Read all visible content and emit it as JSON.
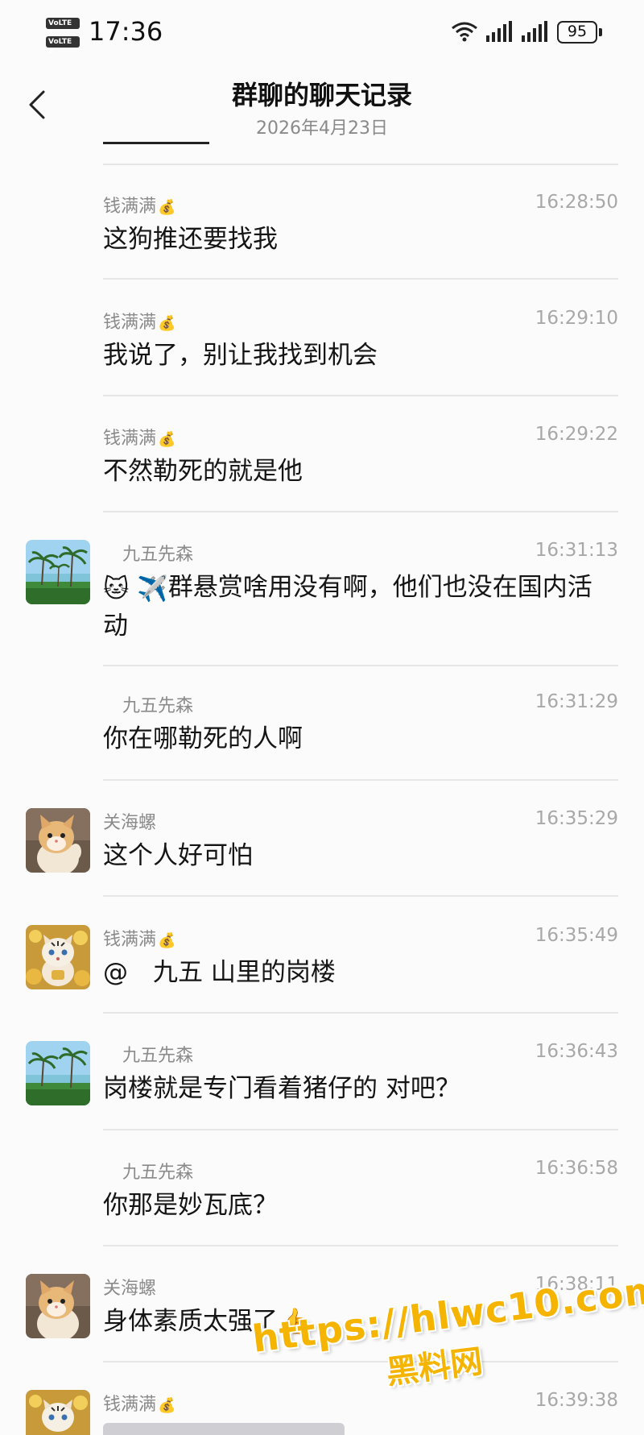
{
  "status_bar": {
    "volte1": "VoLTE 1",
    "volte2": "VoLTE 2",
    "time": "17:36",
    "battery": "95",
    "icons": [
      "wifi-icon",
      "signal-icon",
      "signal-icon",
      "battery-icon"
    ]
  },
  "header": {
    "title": "群聊的聊天记录",
    "date": "2026年4月23日"
  },
  "messages": [
    {
      "sender": "钱满满",
      "badge": "💰",
      "time": "16:28:50",
      "text": "这狗推还要找我",
      "avatar": "none"
    },
    {
      "sender": "钱满满",
      "badge": "💰",
      "time": "16:29:10",
      "text": "我说了，别让我找到机会",
      "avatar": "none"
    },
    {
      "sender": "钱满满",
      "badge": "💰",
      "time": "16:29:22",
      "text": "不然勒死的就是他",
      "avatar": "none"
    },
    {
      "sender": "九五先森",
      "badge": "",
      "time": "16:31:13",
      "text": "群悬赏啥用没有啊，他们也没在国内活动",
      "avatar": "beach-palm-avatar"
    },
    {
      "sender": "九五先森",
      "badge": "",
      "time": "16:31:29",
      "text": "你在哪勒死的人啊",
      "avatar": "none"
    },
    {
      "sender": "关海螺",
      "badge": "",
      "time": "16:35:29",
      "text": "这个人好可怕",
      "avatar": "kitten-avatar"
    },
    {
      "sender": "钱满满",
      "badge": "💰",
      "time": "16:35:49",
      "text": "@　九五  山里的岗楼",
      "avatar": "tiger-gold-avatar"
    },
    {
      "sender": "九五先森",
      "badge": "",
      "time": "16:36:43",
      "text": "岗楼就是专门看着猪仔的  对吧？",
      "avatar": "beach-palm-avatar"
    },
    {
      "sender": "九五先森",
      "badge": "",
      "time": "16:36:58",
      "text": "你那是妙瓦底？",
      "avatar": "none"
    },
    {
      "sender": "关海螺",
      "badge": "",
      "time": "16:38:11",
      "text": "身体素质太强了",
      "avatar": "kitten-avatar"
    },
    {
      "sender": "钱满满",
      "badge": "💰",
      "time": "16:39:38",
      "text": "",
      "avatar": "tiger-gold-avatar"
    }
  ],
  "emoji": {
    "dog": "🐱",
    "plane": "✈️",
    "thumb": "👍"
  },
  "watermark": {
    "url": "https://hlwc10.com",
    "cn": "黑料网"
  }
}
